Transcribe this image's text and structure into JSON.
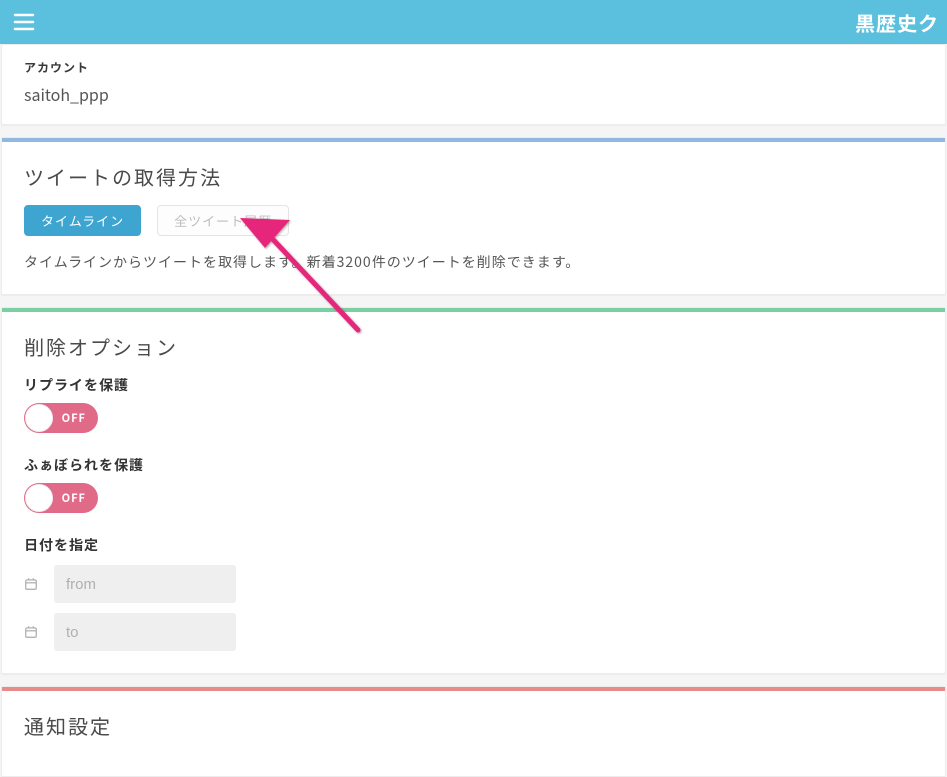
{
  "header": {
    "app_title": "黒歴史ク"
  },
  "account": {
    "label": "アカウント",
    "username": "saitoh_ppp"
  },
  "fetch": {
    "section_title": "ツイートの取得方法",
    "tabs": {
      "timeline": "タイムライン",
      "archive": "全ツイート履歴"
    },
    "helper": "タイムラインからツイートを取得します。新着3200件のツイートを削除できます。"
  },
  "delete_options": {
    "section_title": "削除オプション",
    "protect_replies": {
      "label": "リプライを保護",
      "state": "OFF"
    },
    "protect_faves": {
      "label": "ふぁぼられを保護",
      "state": "OFF"
    },
    "date": {
      "label": "日付を指定",
      "from_placeholder": "from",
      "to_placeholder": "to"
    }
  },
  "notify": {
    "section_title": "通知設定"
  },
  "colors": {
    "accent_blue": "#8fb9e0",
    "accent_green": "#7ad0a3",
    "accent_red": "#e88b8b",
    "primary": "#5bc0de"
  }
}
